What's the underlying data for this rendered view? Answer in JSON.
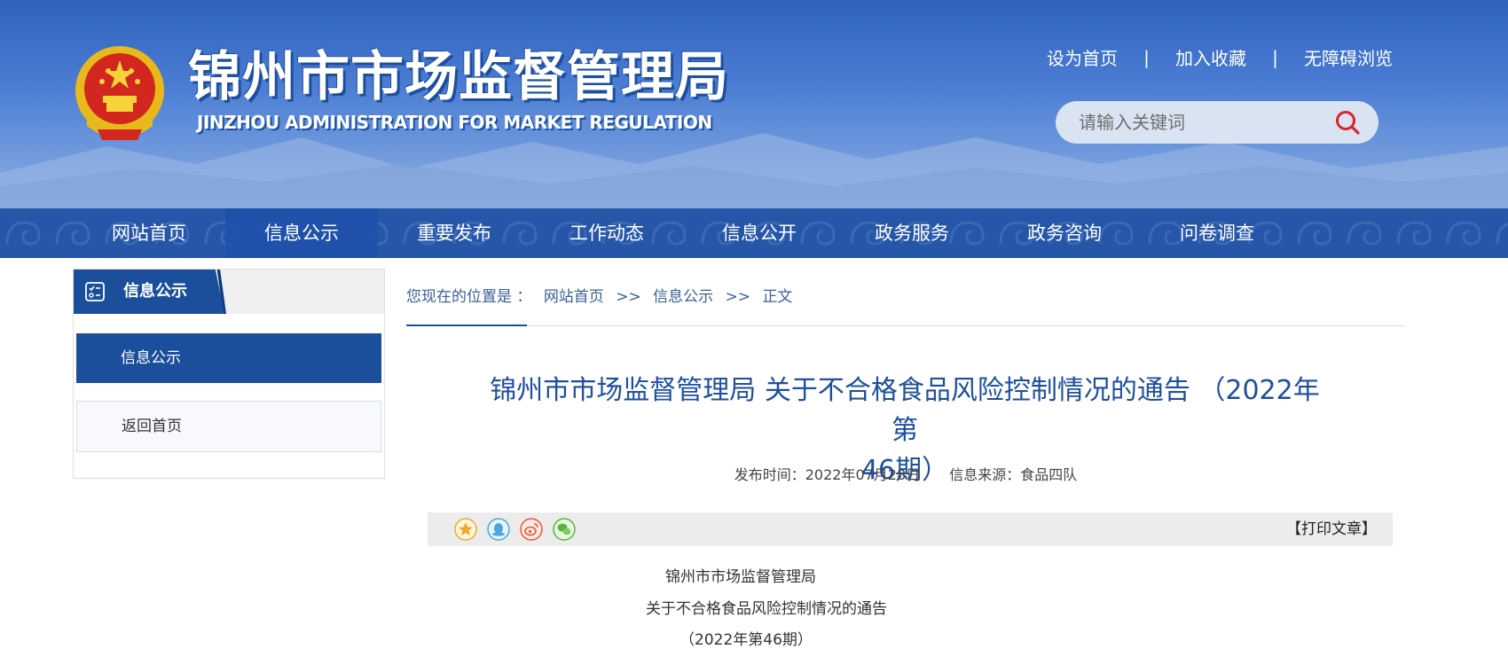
{
  "header": {
    "title": "锦州市市场监督管理局",
    "subtitle": "JINZHOU ADMINISTRATION FOR MARKET REGULATION",
    "links": [
      "设为首页",
      "加入收藏",
      "无障碍浏览"
    ],
    "link_separator": "|",
    "search_placeholder": "请输入关键词"
  },
  "nav": {
    "items": [
      "网站首页",
      "信息公示",
      "重要发布",
      "工作动态",
      "信息公开",
      "政务服务",
      "政务咨询",
      "问卷调查"
    ],
    "active": "信息公示"
  },
  "sidebar": {
    "title": "信息公示",
    "items": [
      "信息公示",
      "返回首页"
    ]
  },
  "breadcrumb": {
    "label": "您现在的位置是 ：",
    "items": [
      "网站首页",
      "信息公示",
      "正文"
    ],
    "separator": ">>"
  },
  "article": {
    "title_line1": "锦州市市场监督管理局 关于不合格食品风险控制情况的通告 （2022年第",
    "title_line2": "46期）",
    "publish_time": "发布时间：2022年07月28日",
    "source": "信息来源：食品四队",
    "print": "【打印文章】",
    "share_icons": [
      "favorite-star-icon",
      "qq-icon",
      "weibo-icon",
      "wechat-icon"
    ],
    "body": [
      "锦州市市场监督管理局",
      "关于不合格食品风险控制情况的通告",
      "（2022年第46期）"
    ]
  },
  "colors": {
    "brand_blue": "#1b4f9b",
    "header_blue": "#4a7cd3",
    "title_blue": "#1e4f9f"
  }
}
